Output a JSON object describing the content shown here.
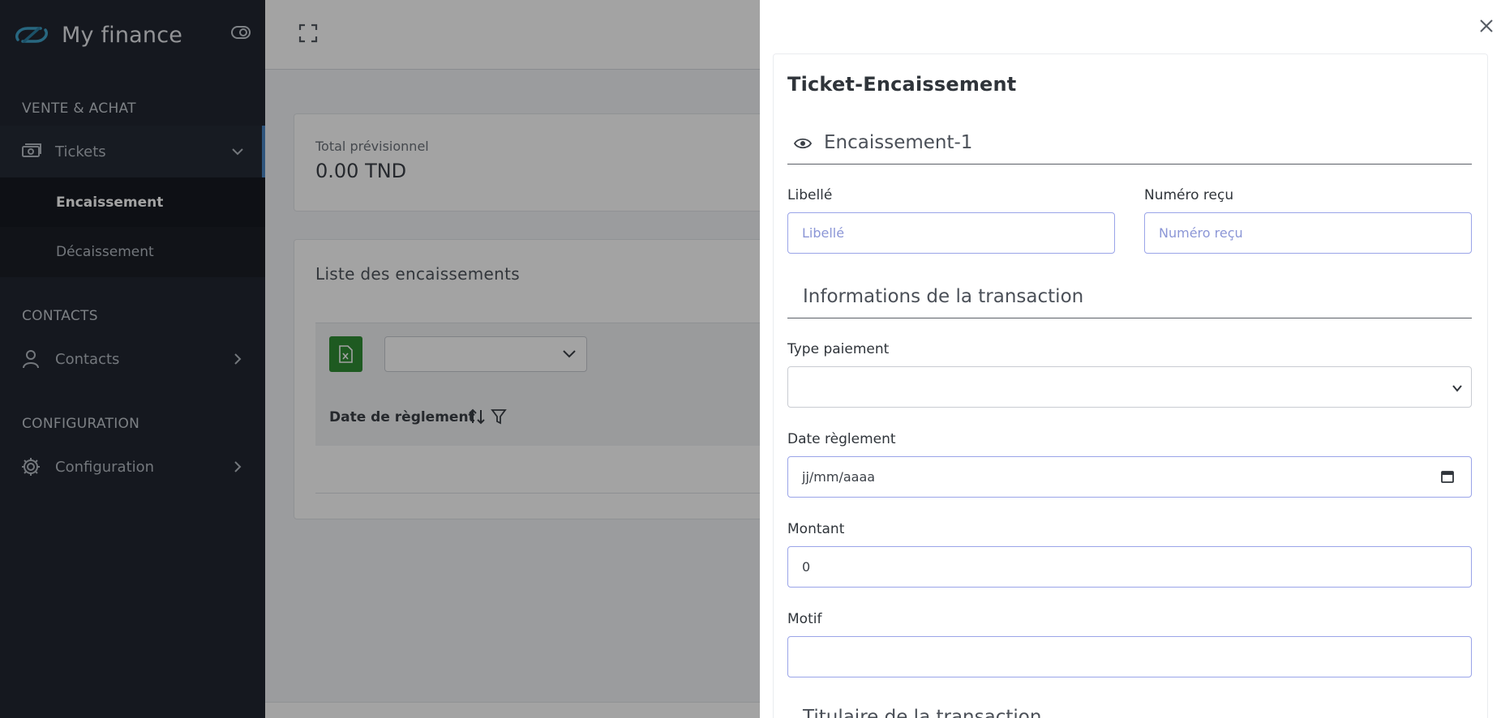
{
  "brand": {
    "name": "My finance"
  },
  "sidebar": {
    "sections": [
      {
        "title": "VENTE & ACHAT"
      },
      {
        "title": "CONTACTS"
      },
      {
        "title": "CONFIGURATION"
      }
    ],
    "items": {
      "tickets": "Tickets",
      "contacts": "Contacts",
      "configuration": "Configuration"
    },
    "sub_items": {
      "encaissement": "Encaissement",
      "decaissement": "Décaissement"
    }
  },
  "main": {
    "total_label": "Total prévisionnel",
    "total_value": "0.00 TND",
    "list_title": "Liste des encaissements",
    "column_date": "Date de règlement"
  },
  "panel": {
    "title": "Ticket-Encaissement",
    "section1": "Encaissement-1",
    "libelle_label": "Libellé",
    "libelle_placeholder": "Libellé",
    "numero_label": "Numéro reçu",
    "numero_placeholder": "Numéro reçu",
    "section2": "Informations de la transaction",
    "type_label": "Type paiement",
    "date_label": "Date règlement",
    "date_placeholder": "jj/mm/aaaa",
    "montant_label": "Montant",
    "montant_value": "0",
    "motif_label": "Motif",
    "section3": "Titulaire de la transaction"
  },
  "colors": {
    "sidebar_bg": "#212631",
    "accent_blue": "#4a86c4",
    "excel_green": "#2f8d35",
    "input_border": "#9aa4e8"
  }
}
